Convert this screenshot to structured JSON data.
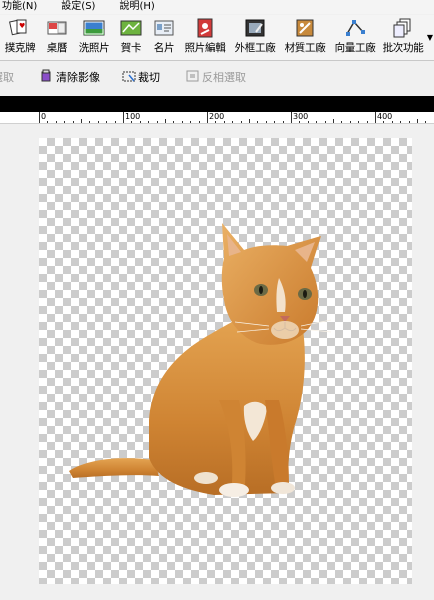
{
  "menu": {
    "items": [
      "功能(N)",
      "設定(S)",
      "說明(H)"
    ]
  },
  "toolbar": {
    "buttons": [
      {
        "label": "撲克牌",
        "icon": "playing-cards-icon"
      },
      {
        "label": "桌曆",
        "icon": "desk-calendar-icon"
      },
      {
        "label": "洗照片",
        "icon": "photo-print-icon"
      },
      {
        "label": "賀卡",
        "icon": "greeting-card-icon"
      },
      {
        "label": "名片",
        "icon": "business-card-icon"
      },
      {
        "label": "照片編輯",
        "icon": "photo-edit-icon"
      },
      {
        "label": "外框工廠",
        "icon": "frame-factory-icon"
      },
      {
        "label": "材質工廠",
        "icon": "texture-factory-icon"
      },
      {
        "label": "向量工廠",
        "icon": "vector-factory-icon"
      },
      {
        "label": "批次功能",
        "icon": "batch-icon"
      }
    ]
  },
  "actions": {
    "select": "選取",
    "clear_image": "清除影像",
    "crop": "裁切",
    "invert_select": "反相選取"
  },
  "ruler": {
    "labels": [
      "0",
      "100",
      "200",
      "300",
      "400"
    ]
  },
  "colors": {
    "checker_dark": "#cccccc",
    "checker_light": "#ffffff",
    "cat_fur": "#d98c3a"
  }
}
